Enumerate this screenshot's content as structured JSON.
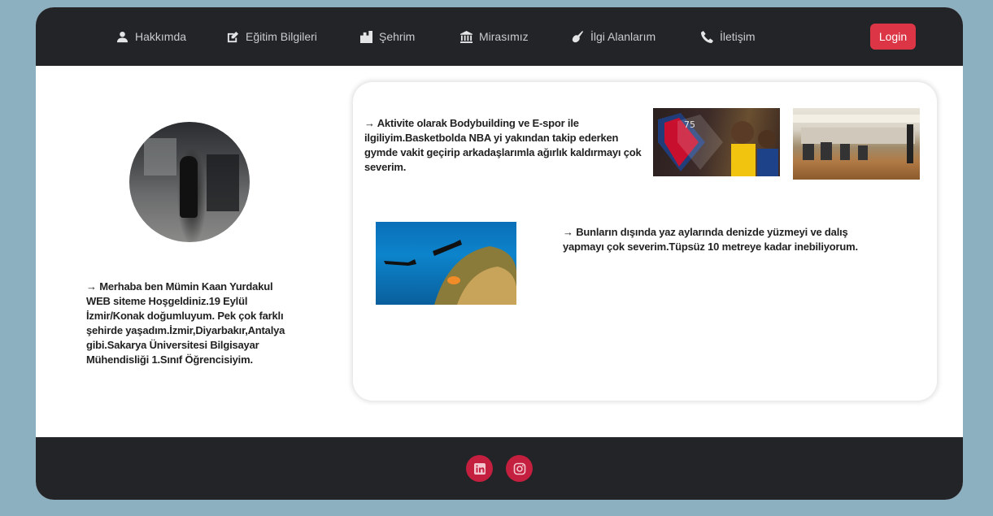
{
  "nav": {
    "items": [
      {
        "label": "Hakkımda",
        "icon": "user-icon"
      },
      {
        "label": "Eğitim Bilgileri",
        "icon": "edit-icon"
      },
      {
        "label": "Şehrim",
        "icon": "city-icon"
      },
      {
        "label": "Mirasımız",
        "icon": "landmark-icon"
      },
      {
        "label": "İlgi Alanlarım",
        "icon": "guitar-icon"
      },
      {
        "label": "İletişim",
        "icon": "phone-icon"
      }
    ],
    "login_label": "Login"
  },
  "profile": {
    "bio": "→ Merhaba ben Mümin Kaan Yurdakul WEB siteme Hoşgeldiniz.19 Eylül İzmir/Konak doğumluyum. Pek çok farklı şehirde yaşadım.İzmir,Diyarbakır,Antalya gibi.Sakarya Üniversitesi Bilgisayar Mühendisliği 1.Sınıf Öğrencisiyim."
  },
  "interests": {
    "text1": "→ Aktivite olarak Bodybuilding ve E-spor ile ilgiliyim.Basketbolda NBA yi yakından takip ederken gymde vakit geçirip arkadaşlarımla ağırlık kaldırmayı çok severim.",
    "text2": "→ Bunların dışında yaz aylarında denizde yüzmeyi ve dalış yapmayı çok severim.Tüpsüz 10 metreye kadar inebiliyorum.",
    "nba_logo_text": "75"
  },
  "footer": {
    "social": [
      {
        "icon": "linkedin-icon"
      },
      {
        "icon": "instagram-icon"
      }
    ]
  },
  "colors": {
    "page_bg": "#8db0c0",
    "dark": "#232427",
    "accent_red": "#dc3545",
    "social_red": "#c51f3f"
  }
}
